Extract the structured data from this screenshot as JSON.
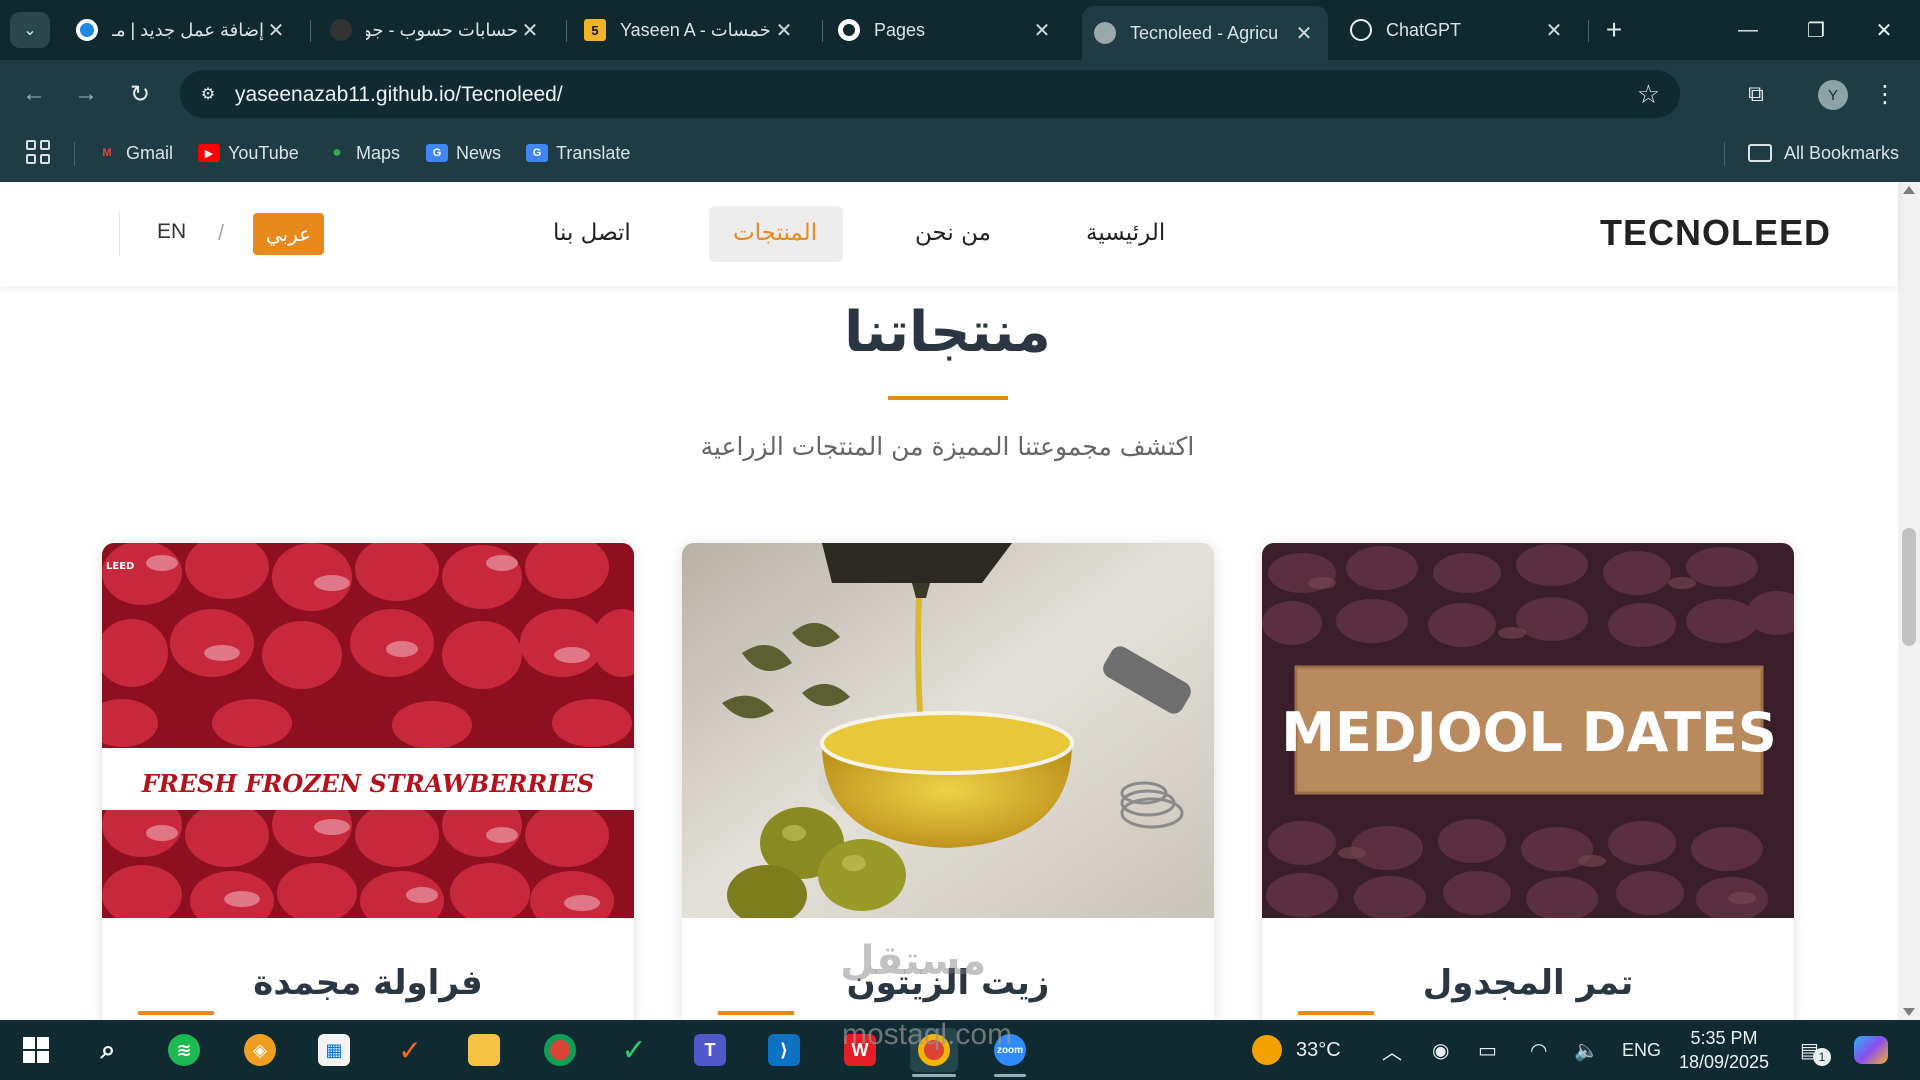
{
  "browser": {
    "tabs": [
      {
        "title": "إضافة عمل جديد | مـ",
        "favicon": "circle-logo",
        "color": "#1e88e5",
        "active": false
      },
      {
        "title": "حسابات حسوب - جو",
        "favicon": "dark-dot",
        "color": "#333333",
        "active": false
      },
      {
        "title": "Yaseen A - خمسات",
        "favicon": "khamsat-5",
        "fav_text": "5",
        "color": "#f0b429",
        "active": false
      },
      {
        "title": "Pages",
        "favicon": "github-icon",
        "color": "#ffffff",
        "active": false
      },
      {
        "title": "Tecnoleed - Agricu",
        "favicon": "globe-icon",
        "color": "#9aa8ab",
        "active": true
      },
      {
        "title": "ChatGPT",
        "favicon": "chatgpt-icon",
        "color": "#e8eff0",
        "active": false
      }
    ],
    "url": "yaseenazab11.github.io/Tecnoleed/",
    "profile_initial": "Y",
    "bookmarks": [
      {
        "label": "Gmail",
        "icon": "gmail-icon",
        "color": "#ea4335",
        "glyph": "M"
      },
      {
        "label": "YouTube",
        "icon": "youtube-icon",
        "color": "#ff0000",
        "glyph": "▶"
      },
      {
        "label": "Maps",
        "icon": "maps-icon",
        "color": "#34a853",
        "glyph": "●"
      },
      {
        "label": "News",
        "icon": "news-icon",
        "color": "#4285f4",
        "glyph": "G"
      },
      {
        "label": "Translate",
        "icon": "translate-icon",
        "color": "#4285f4",
        "glyph": "G"
      }
    ],
    "all_bookmarks": "All Bookmarks"
  },
  "site": {
    "logo": "TECNOLEED",
    "nav": {
      "home": "الرئيسية",
      "about": "من نحن",
      "products": "المنتجات",
      "contact": "اتصل بنا"
    },
    "lang_ar": "عربي",
    "lang_sep": "/",
    "lang_en": "EN",
    "accent_color": "#e88a1a",
    "section_title": "منتجاتنا",
    "section_subtitle": "اكتشف مجموعتنا المميزة من المنتجات الزراعية",
    "products": [
      {
        "name": "تمر المجدول",
        "image_text": "MEDJOOL DATES"
      },
      {
        "name": "زيت الزيتون"
      },
      {
        "name": "فراولة مجمدة",
        "image_text": "FRESH FROZEN STRAWBERRIES",
        "corner_text": "LEED"
      }
    ]
  },
  "watermark": "mostaql.com",
  "watermark_ar": "مستقل",
  "taskbar": {
    "temperature": "33°C",
    "language": "ENG",
    "time": "5:35 PM",
    "date": "18/09/2025",
    "notification_count": "1"
  }
}
